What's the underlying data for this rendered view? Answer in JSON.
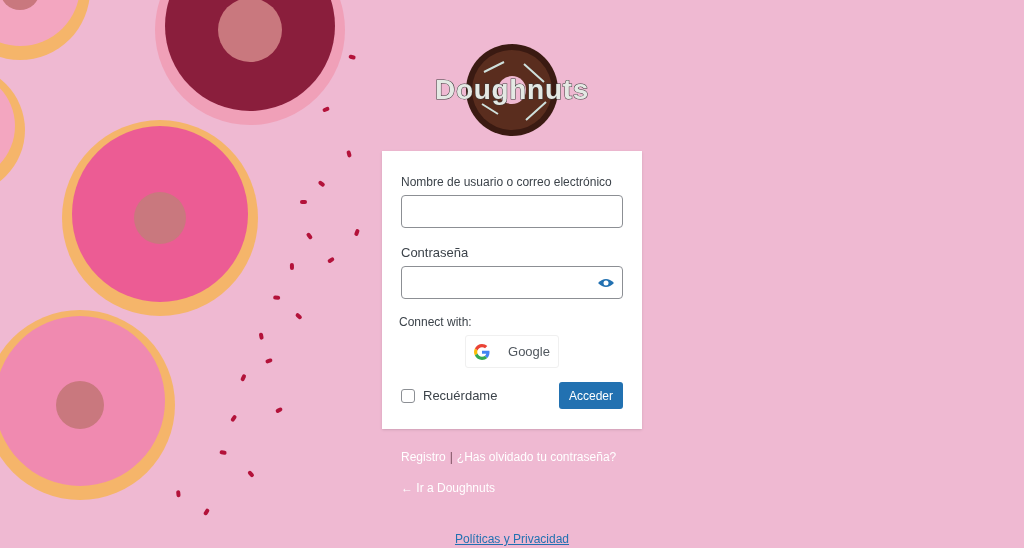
{
  "logo": {
    "text": "Doughnuts"
  },
  "form": {
    "username_label": "Nombre de usuario o correo electrónico",
    "password_label": "Contraseña",
    "connect_label": "Connect with:",
    "providers": [
      {
        "label": "Google"
      }
    ],
    "remember": {
      "label": "Recuérdame",
      "checked": false
    },
    "submit": "Acceder"
  },
  "links": {
    "register": "Registro",
    "separator": "|",
    "lost_password": "¿Has olvidado tu contraseña?",
    "back": "← Ir a Doughnuts"
  },
  "footer": {
    "privacy": "Políticas y Privacidad"
  }
}
